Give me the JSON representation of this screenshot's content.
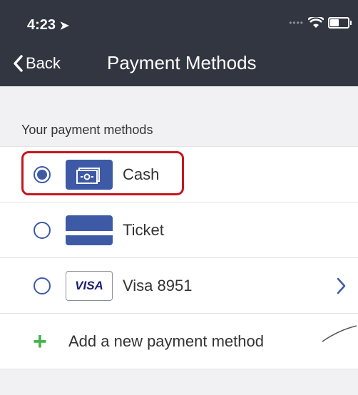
{
  "status_bar": {
    "time": "4:23"
  },
  "nav": {
    "back_label": "Back",
    "title": "Payment Methods"
  },
  "section": {
    "header": "Your payment methods"
  },
  "methods": [
    {
      "label": "Cash",
      "selected": true,
      "logo": "cash-icon"
    },
    {
      "label": "Ticket",
      "selected": false,
      "logo": "ticket-icon"
    },
    {
      "label": "Visa 8951",
      "selected": false,
      "logo": "visa-logo",
      "logo_text": "VISA"
    }
  ],
  "add": {
    "label": "Add a new payment method"
  },
  "colors": {
    "topbar": "#323641",
    "accent": "#3e5aa6",
    "highlight": "#c5161d",
    "plus": "#47b34b"
  }
}
